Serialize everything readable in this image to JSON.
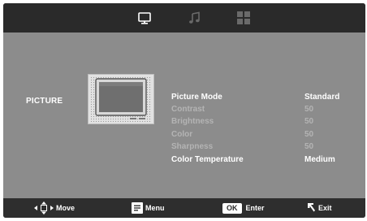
{
  "tabs": [
    {
      "icon": "monitor-icon",
      "active": true
    },
    {
      "icon": "music-note-icon",
      "active": false
    },
    {
      "icon": "grid-icon",
      "active": false
    }
  ],
  "section": {
    "label": "PICTURE"
  },
  "picture_menu": [
    {
      "label": "Picture Mode",
      "value": "Standard",
      "enabled": true
    },
    {
      "label": "Contrast",
      "value": "50",
      "enabled": false
    },
    {
      "label": "Brightness",
      "value": "50",
      "enabled": false
    },
    {
      "label": "Color",
      "value": "50",
      "enabled": false
    },
    {
      "label": "Sharpness",
      "value": "50",
      "enabled": false
    },
    {
      "label": "Color Temperature",
      "value": "Medium",
      "enabled": true
    }
  ],
  "footer": {
    "move_label": "Move",
    "menu_label": "Menu",
    "ok_key": "OK",
    "enter_label": "Enter",
    "exit_label": "Exit"
  },
  "colors": {
    "panel": "#8c8c8c",
    "topbar": "#2a2a2a",
    "bottombar": "#2e2e2e",
    "text_enabled": "#ffffff",
    "text_disabled": "#b4b4b4"
  }
}
